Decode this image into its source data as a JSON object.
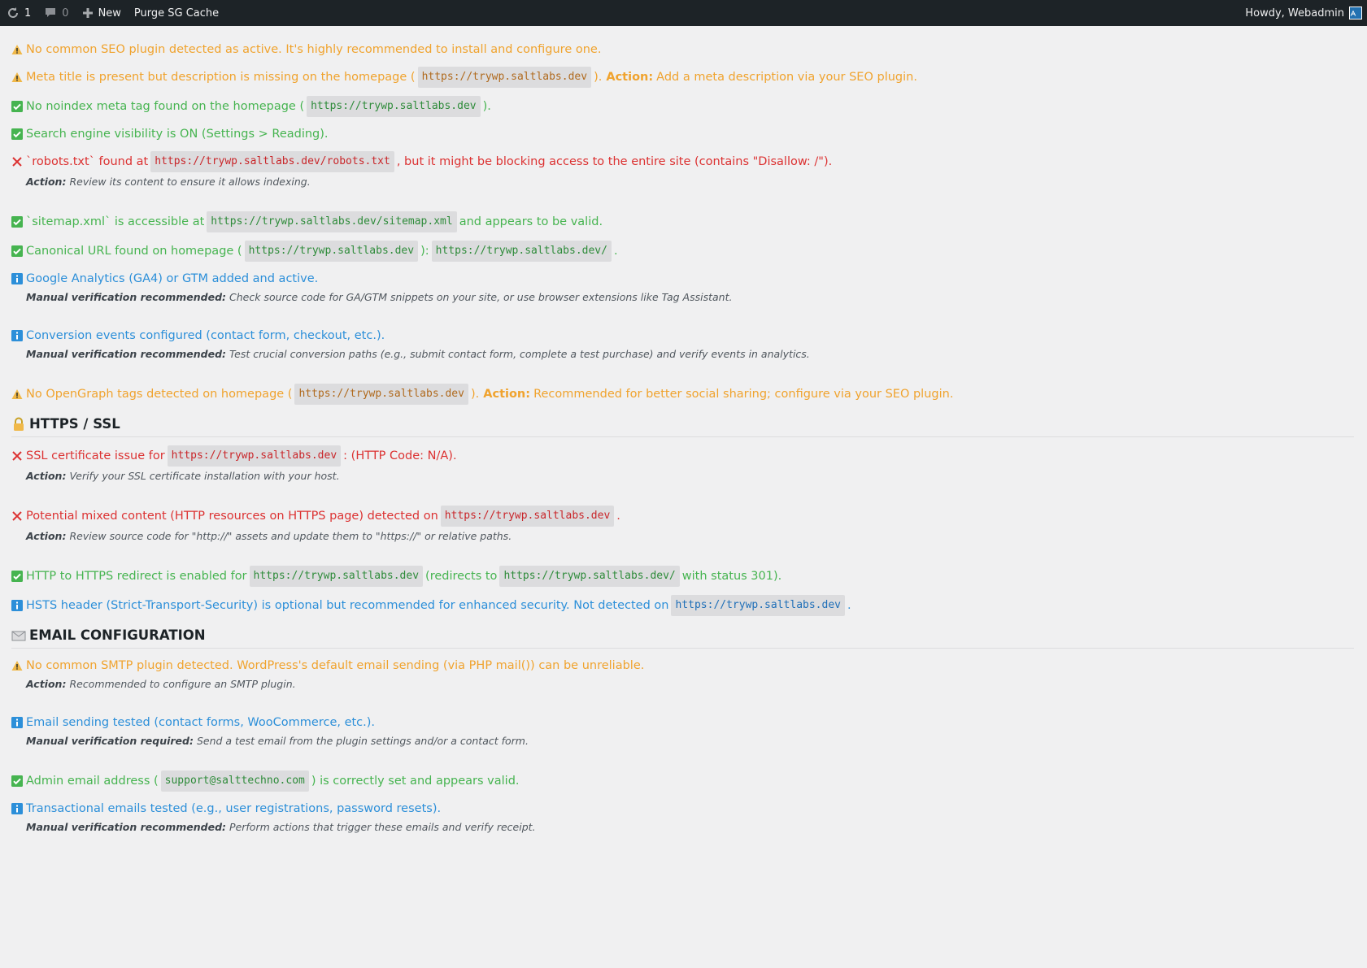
{
  "adminbar": {
    "updates_count": "1",
    "comments_count": "0",
    "new_label": "New",
    "purge_label": "Purge SG Cache",
    "howdy": "Howdy, Webadmin"
  },
  "colors": {
    "warning": "#f0a32e",
    "success": "#46b450",
    "error": "#dc3232",
    "info": "#2c8fd9"
  },
  "seo": {
    "i1": {
      "status": "warning",
      "text": "No common SEO plugin detected as active. It's highly recommended to install and configure one."
    },
    "i2": {
      "status": "warning",
      "pre": "Meta title is present but description is missing on the homepage (",
      "code": "https://trywp.saltlabs.dev",
      "mid": ").",
      "action_label": "Action:",
      "post": "Add a meta description via your SEO plugin."
    },
    "i3": {
      "status": "success",
      "pre": "No noindex meta tag found on the homepage (",
      "code": "https://trywp.saltlabs.dev",
      "post": ")."
    },
    "i4": {
      "status": "success",
      "text": "Search engine visibility is ON (Settings > Reading)."
    },
    "i5": {
      "status": "error",
      "pre": "`robots.txt` found at",
      "code": "https://trywp.saltlabs.dev/robots.txt",
      "post": ", but it might be blocking access to the entire site (contains \"Disallow: /\").",
      "note_label": "Action:",
      "note": "Review its content to ensure it allows indexing."
    },
    "i6": {
      "status": "success",
      "pre": "`sitemap.xml` is accessible at",
      "code": "https://trywp.saltlabs.dev/sitemap.xml",
      "post": "and appears to be valid."
    },
    "i7": {
      "status": "success",
      "pre": "Canonical URL found on homepage (",
      "code": "https://trywp.saltlabs.dev",
      "mid": "):",
      "code2": "https://trywp.saltlabs.dev/",
      "post": "."
    },
    "i8": {
      "status": "info",
      "text": "Google Analytics (GA4) or GTM added and active.",
      "note_label": "Manual verification recommended:",
      "note": "Check source code for GA/GTM snippets on your site, or use browser extensions like Tag Assistant."
    },
    "i9": {
      "status": "info",
      "text": "Conversion events configured (contact form, checkout, etc.).",
      "note_label": "Manual verification recommended:",
      "note": "Test crucial conversion paths (e.g., submit contact form, complete a test purchase) and verify events in analytics."
    },
    "i10": {
      "status": "warning",
      "pre": "No OpenGraph tags detected on homepage (",
      "code": "https://trywp.saltlabs.dev",
      "mid": ").",
      "action_label": "Action:",
      "post": "Recommended for better social sharing; configure via your SEO plugin."
    }
  },
  "https": {
    "title": "HTTPS / SSL",
    "icon": "lock-icon",
    "i1": {
      "status": "error",
      "pre": "SSL certificate issue for",
      "code": "https://trywp.saltlabs.dev",
      "post": ": (HTTP Code: N/A).",
      "note_label": "Action:",
      "note": "Verify your SSL certificate installation with your host."
    },
    "i2": {
      "status": "error",
      "pre": "Potential mixed content (HTTP resources on HTTPS page) detected on",
      "code": "https://trywp.saltlabs.dev",
      "post": ".",
      "note_label": "Action:",
      "note": "Review source code for \"http://\" assets and update them to \"https://\" or relative paths."
    },
    "i3": {
      "status": "success",
      "pre": "HTTP to HTTPS redirect is enabled for",
      "code": "https://trywp.saltlabs.dev",
      "mid": "(redirects to",
      "code2": "https://trywp.saltlabs.dev/",
      "post": "with status 301)."
    },
    "i4": {
      "status": "info",
      "pre": "HSTS header (Strict-Transport-Security) is optional but recommended for enhanced security. Not detected on",
      "code": "https://trywp.saltlabs.dev",
      "post": "."
    }
  },
  "email": {
    "title": "EMAIL CONFIGURATION",
    "icon": "envelope-icon",
    "i1": {
      "status": "warning",
      "text": "No common SMTP plugin detected. WordPress's default email sending (via PHP mail()) can be unreliable.",
      "note_label": "Action:",
      "note": "Recommended to configure an SMTP plugin."
    },
    "i2": {
      "status": "info",
      "text": "Email sending tested (contact forms, WooCommerce, etc.).",
      "note_label": "Manual verification required:",
      "note": "Send a test email from the plugin settings and/or a contact form."
    },
    "i3": {
      "status": "success",
      "pre": "Admin email address (",
      "code": "support@salttechno.com",
      "post": ") is correctly set and appears valid."
    },
    "i4": {
      "status": "info",
      "text": "Transactional emails tested (e.g., user registrations, password resets).",
      "note_label": "Manual verification recommended:",
      "note": "Perform actions that trigger these emails and verify receipt."
    }
  }
}
